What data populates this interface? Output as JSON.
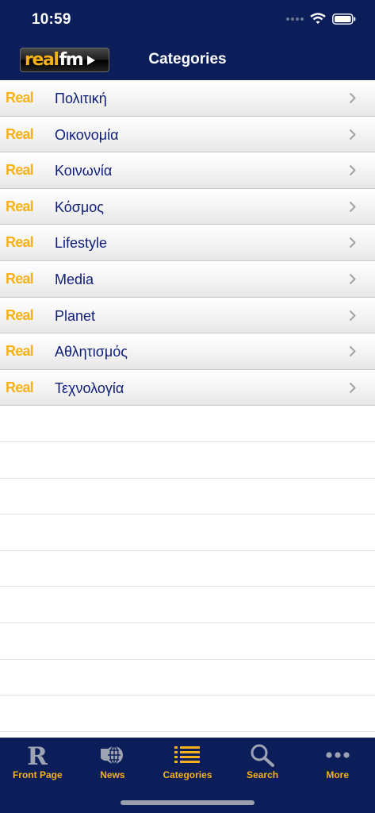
{
  "status": {
    "time": "10:59"
  },
  "header": {
    "logo_real": "real",
    "logo_fm": "fm",
    "title": "Categories"
  },
  "list": {
    "tag": "Real",
    "items": [
      "Πολιτική",
      "Οικονομία",
      "Κοινωνία",
      "Κόσμος",
      "Lifestyle",
      "Media",
      "Planet",
      "Αθλητισμός",
      "Τεχνολογία"
    ]
  },
  "tabs": [
    {
      "label": "Front Page",
      "icon": "r-letter-icon"
    },
    {
      "label": "News",
      "icon": "globe-icon"
    },
    {
      "label": "Categories",
      "icon": "list-icon"
    },
    {
      "label": "Search",
      "icon": "search-icon"
    },
    {
      "label": "More",
      "icon": "more-dots-icon"
    }
  ],
  "colors": {
    "navy": "#0b1e5a",
    "accent": "#f6b21a",
    "label": "#0f1e78"
  }
}
